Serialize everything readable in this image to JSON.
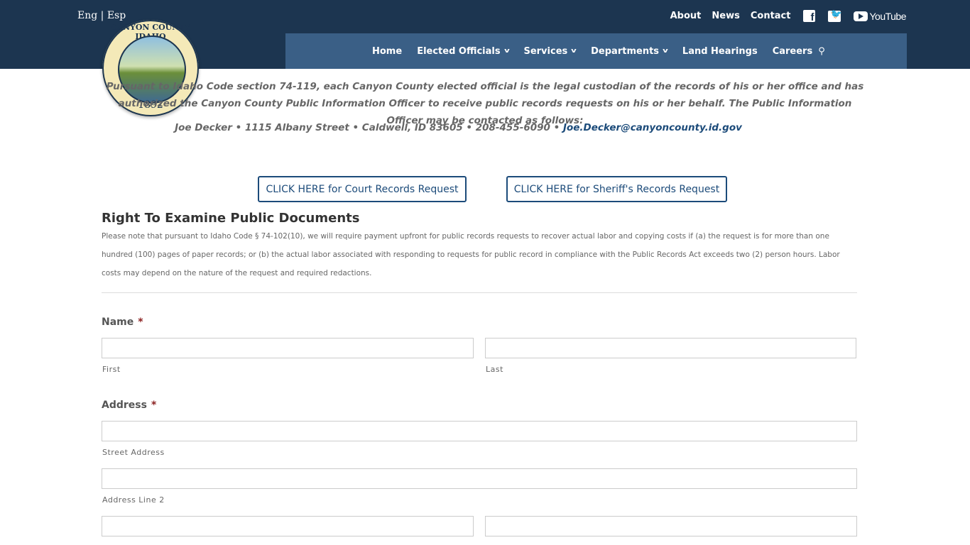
{
  "header": {
    "lang_en": "Eng",
    "lang_sep": " | ",
    "lang_es": "Esp",
    "top_links": [
      "About",
      "News",
      "Contact"
    ],
    "youtube_label": "YouTube",
    "seal_text": "CANYON COUNTY IDAHO",
    "seal_year": "1892",
    "nav": [
      "Home",
      "Elected Officials",
      "Services",
      "Departments",
      "Land Hearings",
      "Careers"
    ],
    "nav_dropdowns": [
      false,
      true,
      true,
      true,
      false,
      false
    ],
    "colors": {
      "topbar": "#1c3550",
      "navbar": "#3a5f86",
      "accent": "#1c4b7a"
    }
  },
  "intro": {
    "text": "Pursuant to Idaho Code section 74-119, each Canyon County elected official is the legal custodian of the records of his or her office and has authorized the Canyon County Public Information Officer to receive public records requests on his or her behalf. The Public Information Officer may be contacted as follows:",
    "contact_text": "Joe Decker • 1115 Albany Street • Caldwell, ID 83605 • 208-455-6090 • ",
    "contact_email": "Joe.Decker@canyoncounty.id.gov"
  },
  "buttons": {
    "court": "CLICK HERE for Court Records Request",
    "sheriff": "CLICK HERE for Sheriff's Records Request"
  },
  "section": {
    "title": "Right To Examine Public Documents",
    "notice": "Please note that pursuant to Idaho Code § 74-102(10), we will require payment upfront for public records requests to recover actual labor and copying costs if (a) the request is for more than one hundred (100) pages of paper records; or (b) the actual labor associated with responding to requests for public record in compliance with the Public Records Act exceeds two (2) person hours. Labor costs may depend on the nature of the request and required redactions."
  },
  "form": {
    "name_label": "Name",
    "required_mark": "*",
    "first_label": "First",
    "last_label": "Last",
    "address_label": "Address",
    "street_label": "Street Address",
    "line2_label": "Address Line 2",
    "first_value": "",
    "last_value": "",
    "street_value": "",
    "line2_value": ""
  }
}
